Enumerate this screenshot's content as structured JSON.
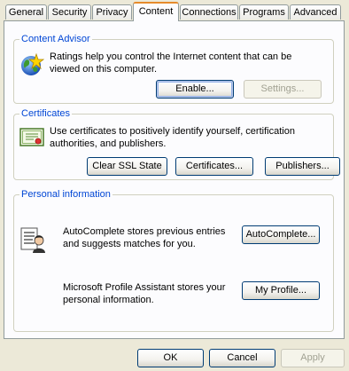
{
  "tabs": [
    {
      "label": "General"
    },
    {
      "label": "Security"
    },
    {
      "label": "Privacy"
    },
    {
      "label": "Content"
    },
    {
      "label": "Connections"
    },
    {
      "label": "Programs"
    },
    {
      "label": "Advanced"
    }
  ],
  "content_advisor": {
    "title": "Content Advisor",
    "description_line1": "Ratings help you control the Internet content that can be",
    "description_line2": "viewed on this computer.",
    "enable_label": "Enable...",
    "settings_label": "Settings..."
  },
  "certificates": {
    "title": "Certificates",
    "description_line1": "Use certificates to positively identify yourself, certification",
    "description_line2": "authorities, and publishers.",
    "clear_ssl_label": "Clear SSL State",
    "certificates_label": "Certificates...",
    "publishers_label": "Publishers..."
  },
  "personal_information": {
    "title": "Personal information",
    "autocomplete_line1": "AutoComplete stores previous entries",
    "autocomplete_line2": "and suggests matches for you.",
    "autocomplete_label": "AutoComplete...",
    "profile_line1": "Microsoft Profile Assistant stores your",
    "profile_line2": "personal information.",
    "my_profile_label": "My Profile..."
  },
  "footer": {
    "ok_label": "OK",
    "cancel_label": "Cancel",
    "apply_label": "Apply"
  },
  "colors": {
    "dialog_bg": "#ece9d8",
    "page_bg": "#fcfcfe",
    "group_title": "#0046d5",
    "active_tab_accent": "#e68b2c"
  }
}
